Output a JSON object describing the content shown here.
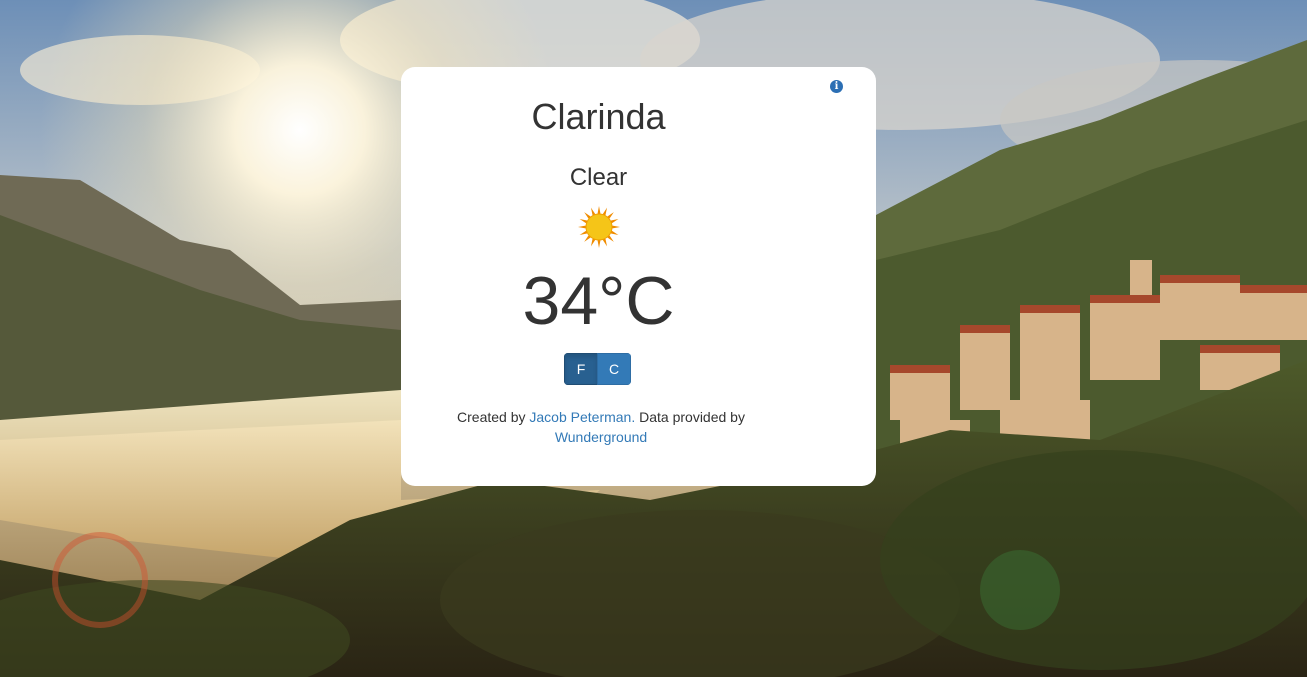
{
  "location": {
    "city": "Clarinda"
  },
  "weather": {
    "condition": "Clear",
    "icon": "sun-icon",
    "temperature_display": "34°C",
    "temperature_value": 34,
    "temperature_unit": "C"
  },
  "units": {
    "fahrenheit_label": "F",
    "celsius_label": "C",
    "active": "F"
  },
  "credits": {
    "created_by_prefix": "Created by",
    "author_link": "Jacob Peterman.",
    "data_prefix": "Data provided by",
    "data_source_link": "Wunderground"
  },
  "info": {
    "icon": "info-icon",
    "glyph": "i"
  },
  "colors": {
    "card_background": "#ffffff",
    "text": "#333333",
    "link": "#337ab7",
    "button_primary": "#337ab7",
    "button_active": "#286090",
    "sun_core": "#f5c518",
    "sun_rays": "#f08c00"
  }
}
